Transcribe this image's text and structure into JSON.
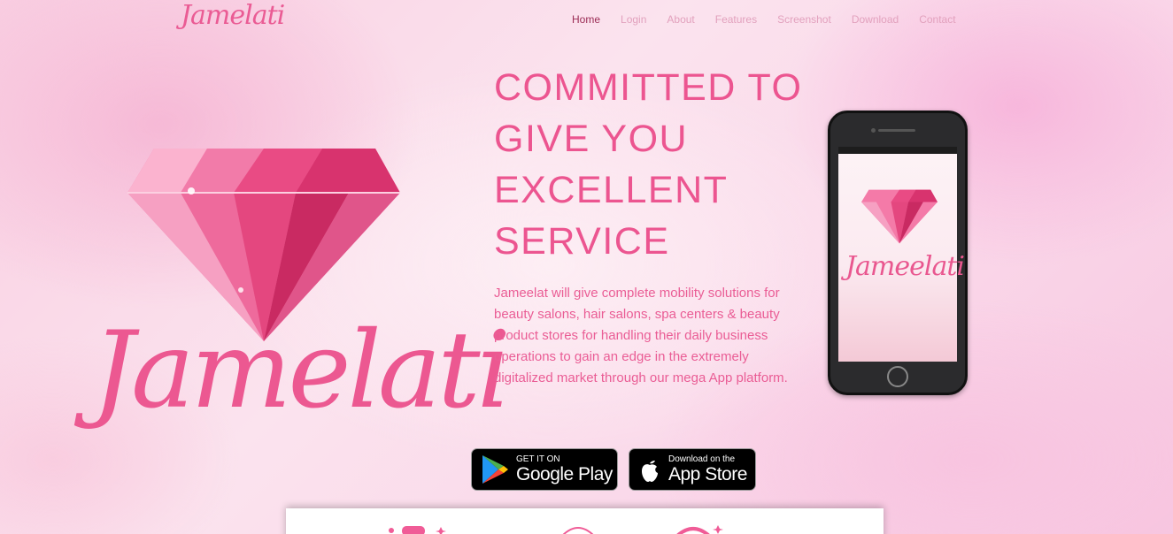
{
  "brand": {
    "logo_text": "Jamelati"
  },
  "nav": {
    "items": [
      {
        "label": "Home",
        "active": true
      },
      {
        "label": "Login"
      },
      {
        "label": "About"
      },
      {
        "label": "Features"
      },
      {
        "label": "Screenshot"
      },
      {
        "label": "Download"
      },
      {
        "label": "Contact"
      }
    ]
  },
  "hero": {
    "logo_word": "Jamelati",
    "headline": "COMMITTED TO GIVE YOU EXCELLENT SERVICE",
    "description": "Jameelat will give complete mobility solutions for beauty salons, hair salons, spa centers & beauty product stores for handling their daily business operations to gain an edge in the extremely digitalized market through our mega App platform.",
    "phone_screen_text": "Jameelati"
  },
  "stores": {
    "google": {
      "small": "GET IT ON",
      "big": "Google Play"
    },
    "apple": {
      "small": "Download on the",
      "big": "App Store"
    }
  },
  "colors": {
    "accent": "#ec5590",
    "nav_active": "#9b2c55",
    "nav_inactive": "#e2a1bd"
  }
}
